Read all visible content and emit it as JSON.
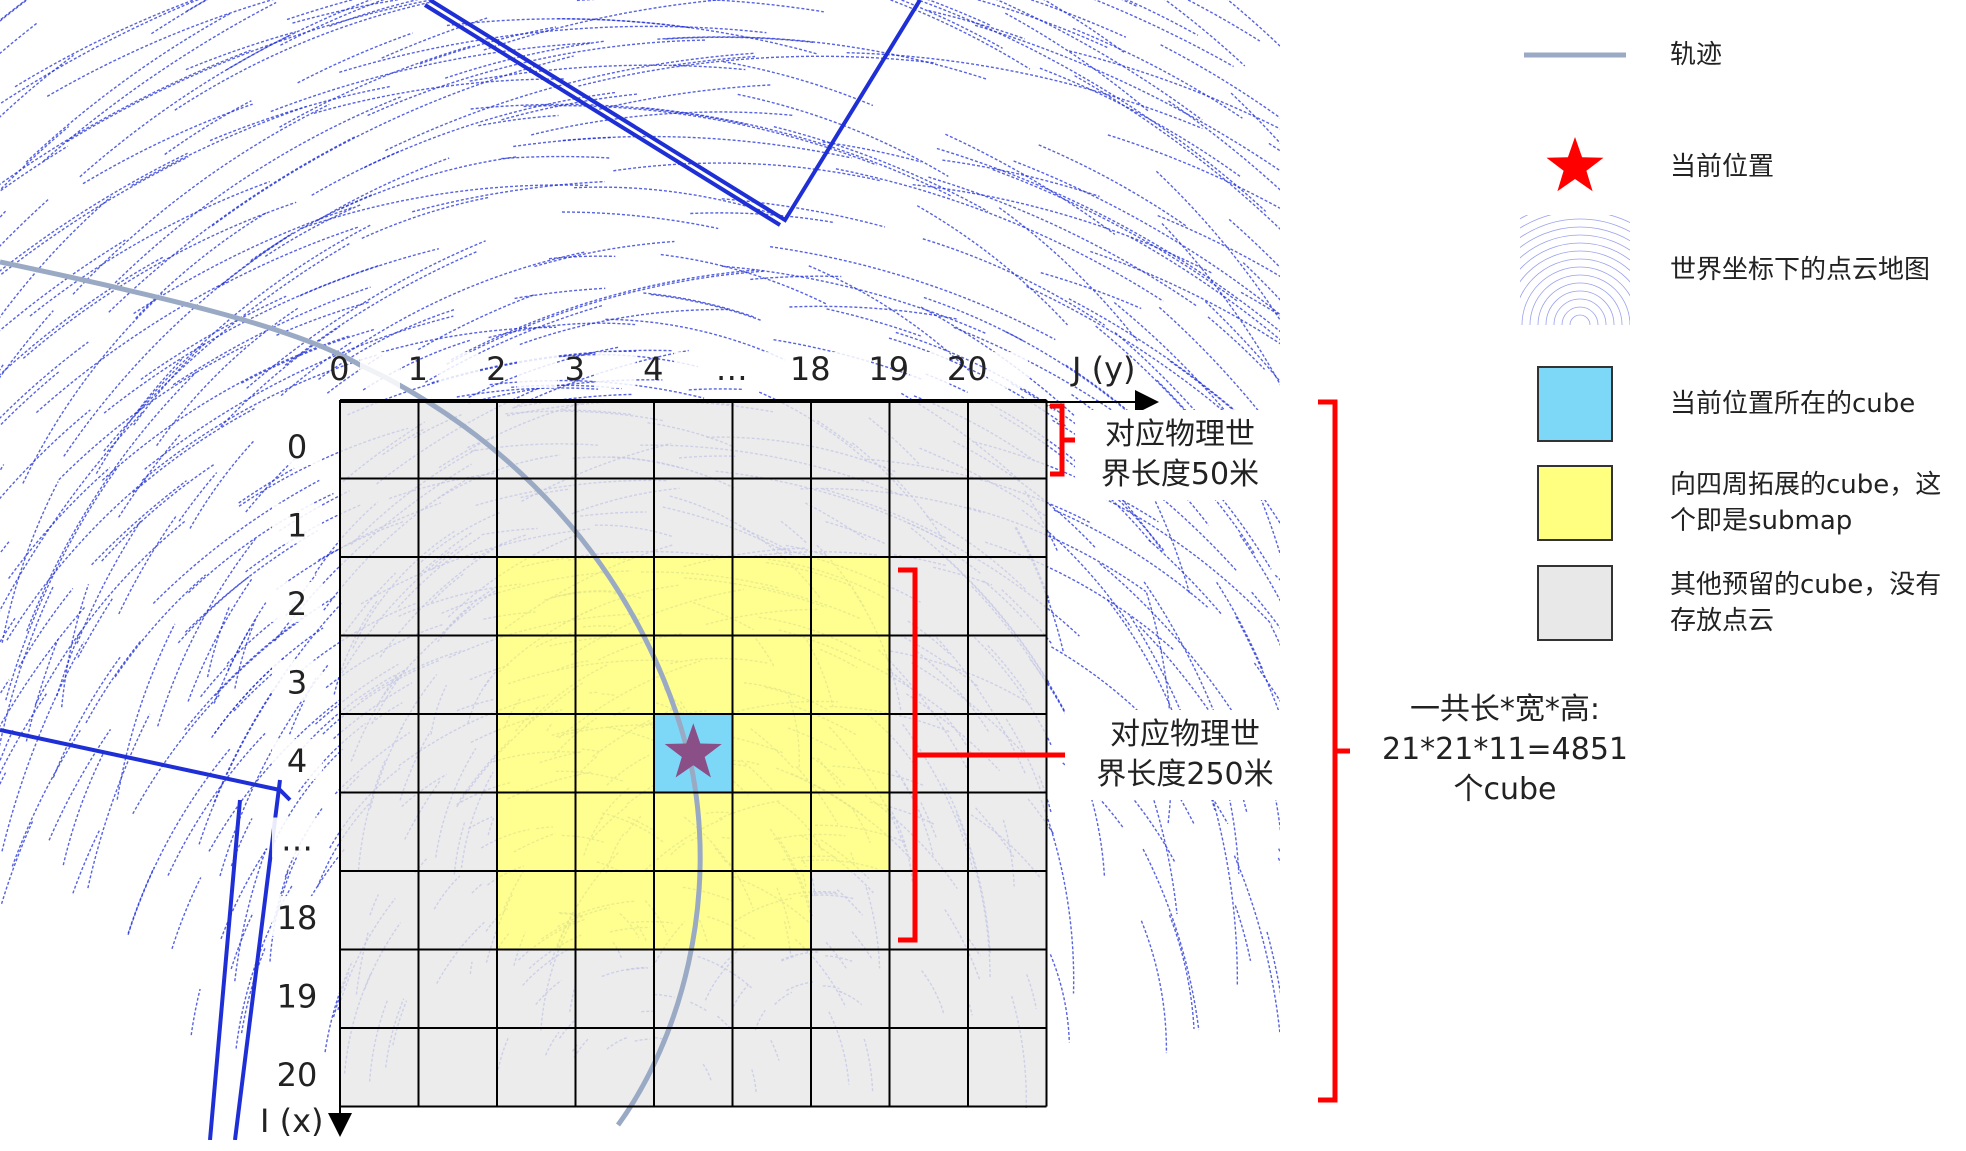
{
  "grid": {
    "column_labels": [
      "0",
      "1",
      "2",
      "3",
      "4",
      "…",
      "18",
      "19",
      "20"
    ],
    "row_labels": [
      "0",
      "1",
      "2",
      "3",
      "4",
      "…",
      "18",
      "19",
      "20"
    ],
    "j_axis_label": "J (y)",
    "i_axis_label": "I (x)",
    "current_cell": {
      "row": 4,
      "col": 4
    },
    "submap_rows": [
      2,
      6
    ],
    "submap_cols": [
      2,
      6
    ]
  },
  "annotations": {
    "cell_size": "对应物理世\n界长度50米",
    "submap_size": "对应物理世\n界长度250米",
    "total": "一共长*宽*高:\n21*21*11=4851\n个cube"
  },
  "legend": [
    {
      "symbol": "line",
      "label": "轨迹"
    },
    {
      "symbol": "star",
      "label": "当前位置"
    },
    {
      "symbol": "pointcloud",
      "label": "世界坐标下的点云地图"
    },
    {
      "symbol": "swatch",
      "color": "#7dd8f7",
      "label": "当前位置所在的cube"
    },
    {
      "symbol": "swatch",
      "color": "#ffff80",
      "label": "向四周拓展的cube，这\n个即是submap"
    },
    {
      "symbol": "swatch",
      "color": "#e8e8e8",
      "label": "其他预留的cube，没有\n存放点云"
    }
  ],
  "colors": {
    "trajectory": "#9aaac4",
    "points": "#1f2fd6",
    "current": "#7dd8f7",
    "submap": "#ffff80",
    "reserved": "#e8e8e8",
    "star_legend": "#ff0000",
    "star_grid": "#8a4f86",
    "brace": "#ff0000"
  }
}
